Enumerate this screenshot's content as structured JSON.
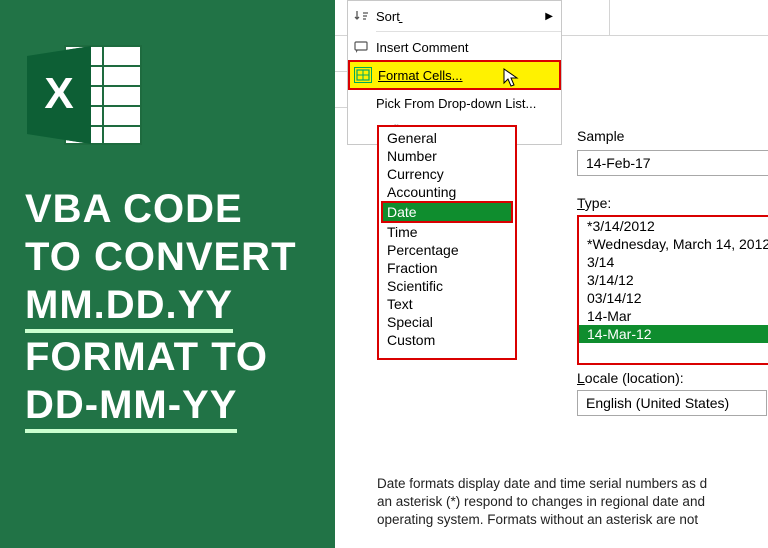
{
  "left": {
    "line1": "VBA CODE",
    "line2": "TO CONVERT",
    "line3": "MM.DD.YY",
    "line4": "FORMAT TO",
    "line5": "DD-MM-YY"
  },
  "ctx": {
    "sort": "Sort",
    "insert_comment": "Insert Comment",
    "format_cells": "Format Cells...",
    "pick_list": "Pick From Drop-down List...",
    "define": "Define"
  },
  "categories": {
    "items": [
      "General",
      "Number",
      "Currency",
      "Accounting",
      "Date",
      "Time",
      "Percentage",
      "Fraction",
      "Scientific",
      "Text",
      "Special",
      "Custom"
    ],
    "selected": "Date"
  },
  "sample": {
    "label": "Sample",
    "value": "14-Feb-17"
  },
  "type": {
    "label_pre": "T",
    "label_rest": "ype:",
    "items": [
      "*3/14/2012",
      "*Wednesday, March 14, 2012",
      "3/14",
      "3/14/12",
      "03/14/12",
      "14-Mar",
      "14-Mar-12"
    ],
    "selected": "14-Mar-12"
  },
  "locale": {
    "label_pre": "L",
    "label_rest": "ocale (location):",
    "value": "English (United States)"
  },
  "desc": {
    "l1": "Date formats display date and time serial numbers as d",
    "l2": "an asterisk (*) respond to changes in regional date and",
    "l3": "operating system. Formats without an asterisk are not"
  },
  "icons": {
    "excel_x": "X"
  }
}
